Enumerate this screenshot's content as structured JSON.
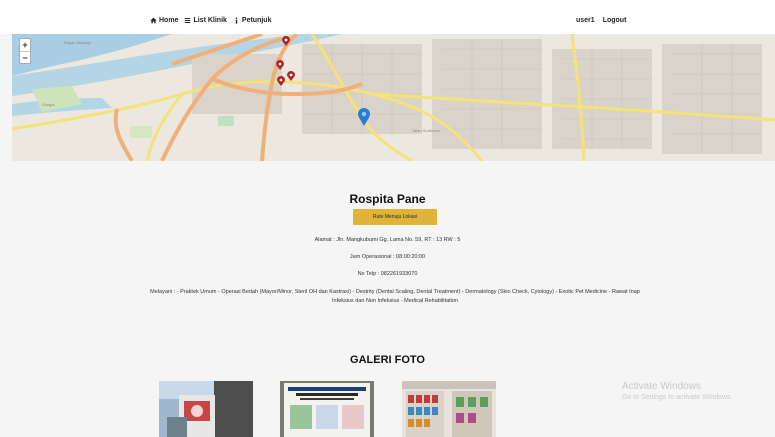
{
  "nav": {
    "home": "Home",
    "list_klinik": "List Klinik",
    "petunjuk": "Petunjuk",
    "user": "user1",
    "logout": "Logout"
  },
  "map": {
    "zoom_in": "+",
    "zoom_out": "−"
  },
  "clinic": {
    "name": "Rospita Pane",
    "route_button": "Rute Menuju Lokasi",
    "address": "Alamat : Jln. Mangkubumi Gg. Lama No. 59, RT : 13 RW : 5",
    "hours": "Jam Operasional : 08:00:20:00",
    "phone": "No Telp : 082261933070",
    "services": "Melayani : - Praktek Umum - Operasi Bedah (Mayor/Minor, Steril OH dan Kastrasi) - Destrity (Dental Scaling, Dental Treatment) - Dermatology (Skin Check, Cytology) - Exotic Pet Medicine - Rawat Inap Infeksius dan Non Infeksius - Medical Rehabilitation"
  },
  "gallery": {
    "title": "GALERI FOTO"
  },
  "watermark": {
    "line1": "Activate Windows",
    "line2": "Go to Settings to activate Windows."
  }
}
